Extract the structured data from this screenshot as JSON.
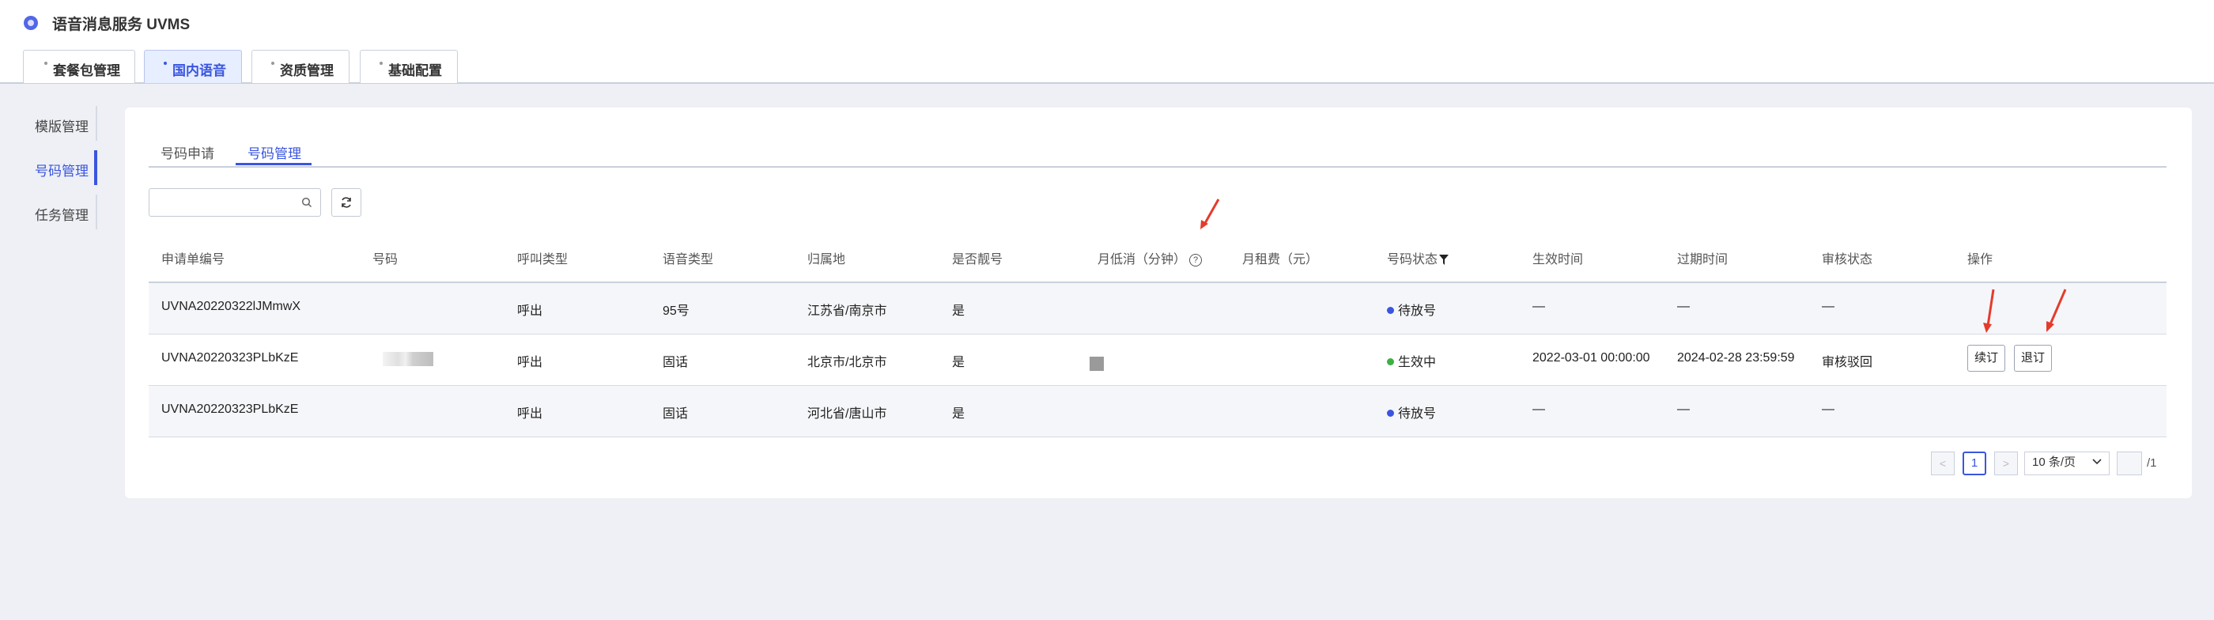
{
  "app": {
    "title": "语音消息服务 UVMS"
  },
  "main_tabs": [
    {
      "label": "套餐包管理"
    },
    {
      "label": "国内语音"
    },
    {
      "label": "资质管理"
    },
    {
      "label": "基础配置"
    }
  ],
  "sidebar": {
    "items": [
      {
        "label": "模版管理"
      },
      {
        "label": "号码管理"
      },
      {
        "label": "任务管理"
      }
    ]
  },
  "sub_tabs": [
    {
      "label": "号码申请"
    },
    {
      "label": "号码管理"
    }
  ],
  "search": {
    "value": "",
    "placeholder": ""
  },
  "table": {
    "headers": {
      "order_no": "申请单编号",
      "number": "号码",
      "call_type": "呼叫类型",
      "voice_type": "语音类型",
      "location": "归属地",
      "premium": "是否靓号",
      "min_spend": "月低消（分钟）",
      "rent": "月租费（元）",
      "status": "号码状态",
      "start": "生效时间",
      "expire": "过期时间",
      "audit": "审核状态",
      "actions": "操作"
    },
    "rows": [
      {
        "order_no": "UVNA20220322lJMmwX",
        "number": "",
        "call_type": "呼出",
        "voice_type": "95号",
        "location": "江苏省/南京市",
        "premium": "是",
        "min_spend": "",
        "rent": "",
        "status": "待放号",
        "start": "—",
        "expire": "—",
        "audit": "—"
      },
      {
        "order_no": "UVNA20220323PLbKzE",
        "number": "",
        "call_type": "呼出",
        "voice_type": "固话",
        "location": "北京市/北京市",
        "premium": "是",
        "min_spend": "",
        "rent": "",
        "status": "生效中",
        "start": "2022-03-01 00:00:00",
        "expire": "2024-02-28 23:59:59",
        "audit": "审核驳回"
      },
      {
        "order_no": "UVNA20220323PLbKzE",
        "number": "",
        "call_type": "呼出",
        "voice_type": "固话",
        "location": "河北省/唐山市",
        "premium": "是",
        "min_spend": "",
        "rent": "",
        "status": "待放号",
        "start": "—",
        "expire": "—",
        "audit": "—"
      }
    ],
    "row_actions": {
      "renew": "续订",
      "cancel": "退订"
    }
  },
  "status_colors": {
    "pending": "#3a55e0",
    "active": "#3cb043",
    "accent": "#3a55e0",
    "arrow": "#e53b2c"
  },
  "pagination": {
    "current_page": "1",
    "page_size": "10 条/页",
    "total": "/1",
    "prev": "<",
    "next": ">"
  }
}
